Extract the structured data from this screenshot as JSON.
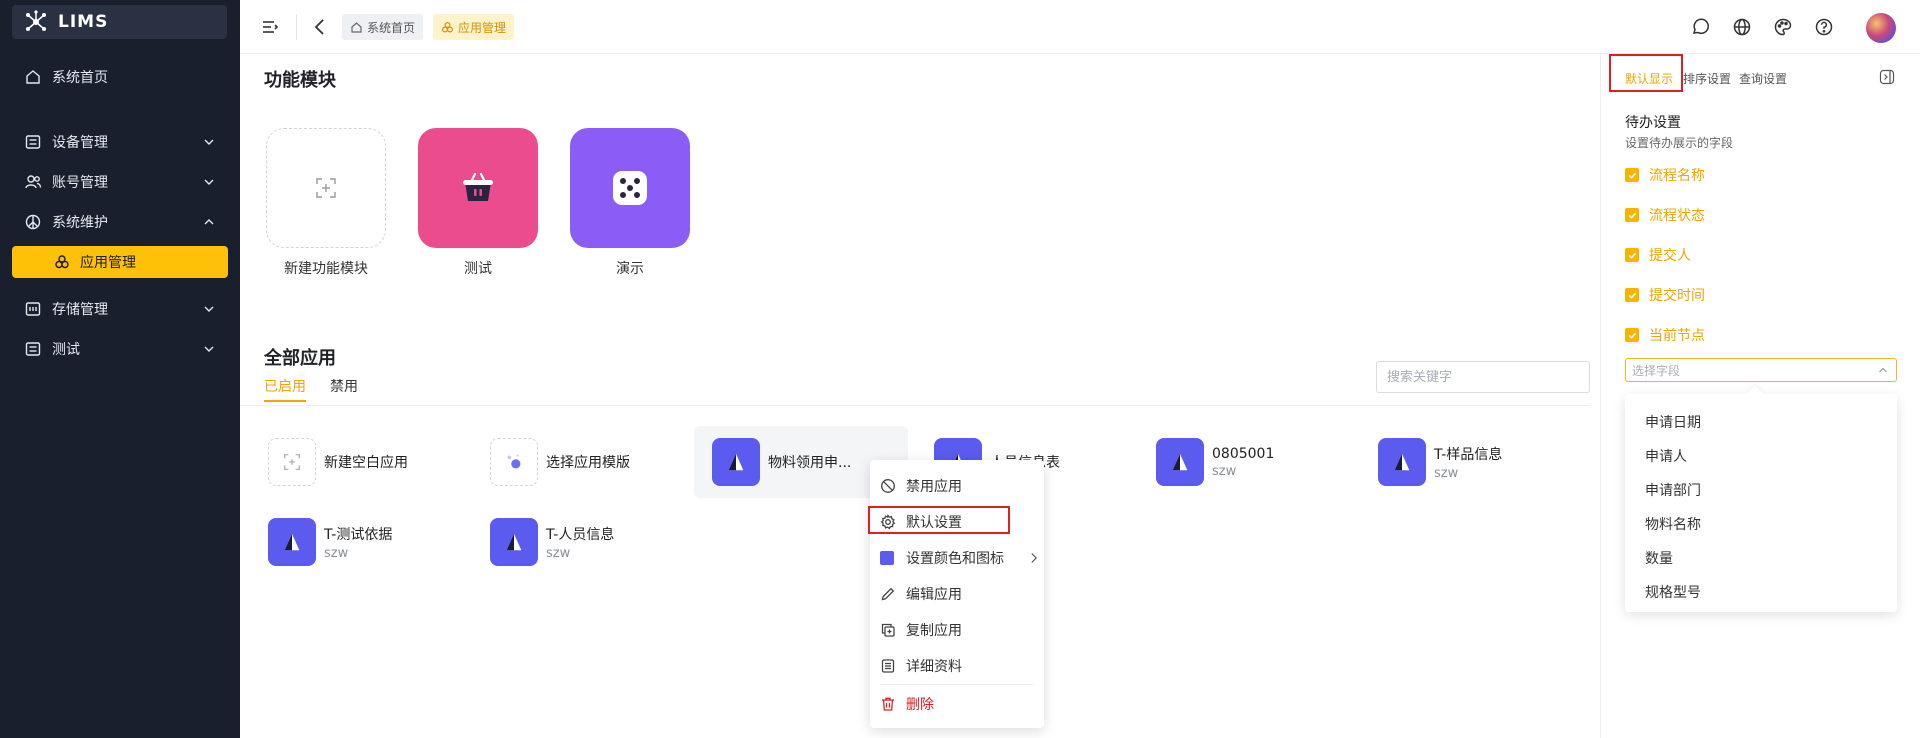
{
  "sidebar": {
    "logo_text": "LIMS",
    "items": [
      {
        "label": "系统首页"
      },
      {
        "label": "设备管理"
      },
      {
        "label": "账号管理"
      },
      {
        "label": "系统维护"
      },
      {
        "label": "应用管理"
      },
      {
        "label": "存储管理"
      },
      {
        "label": "测试"
      }
    ]
  },
  "header": {
    "breadcrumb_home": "系统首页",
    "breadcrumb_current": "应用管理"
  },
  "modules": {
    "title": "功能模块",
    "items": [
      {
        "label": "新建功能模块"
      },
      {
        "label": "测试"
      },
      {
        "label": "演示"
      }
    ]
  },
  "apps": {
    "title": "全部应用",
    "tabs": [
      "已启用",
      "禁用"
    ],
    "search_placeholder": "搜索关键字",
    "items": [
      {
        "name": "新建空白应用"
      },
      {
        "name": "选择应用模版"
      },
      {
        "name": "物料领用申..."
      },
      {
        "name": "人员信息表"
      },
      {
        "name": "0805001",
        "sub": "szw"
      },
      {
        "name": "T-样品信息",
        "sub": "szw"
      },
      {
        "name": "T-测试依据",
        "sub": "szw"
      },
      {
        "name": "T-人员信息",
        "sub": "szw"
      }
    ]
  },
  "context_menu": {
    "items": [
      {
        "label": "禁用应用"
      },
      {
        "label": "默认设置"
      },
      {
        "label": "设置颜色和图标"
      },
      {
        "label": "编辑应用"
      },
      {
        "label": "复制应用"
      },
      {
        "label": "详细资料"
      },
      {
        "label": "删除"
      }
    ]
  },
  "right_panel": {
    "tabs": [
      "默认显示",
      "排序设置",
      "查询设置"
    ],
    "title": "待办设置",
    "subtitle": "设置待办展示的字段",
    "checked_fields": [
      "流程名称",
      "流程状态",
      "提交人",
      "提交时间",
      "当前节点"
    ],
    "select_placeholder": "选择字段",
    "dropdown_options": [
      "申请日期",
      "申请人",
      "申请部门",
      "物料名称",
      "数量",
      "规格型号"
    ]
  },
  "colors": {
    "accent": "#ffc107",
    "sidebar_bg": "#1a1f2e",
    "app_icon": "#5b5bf0",
    "danger": "#e02020"
  }
}
